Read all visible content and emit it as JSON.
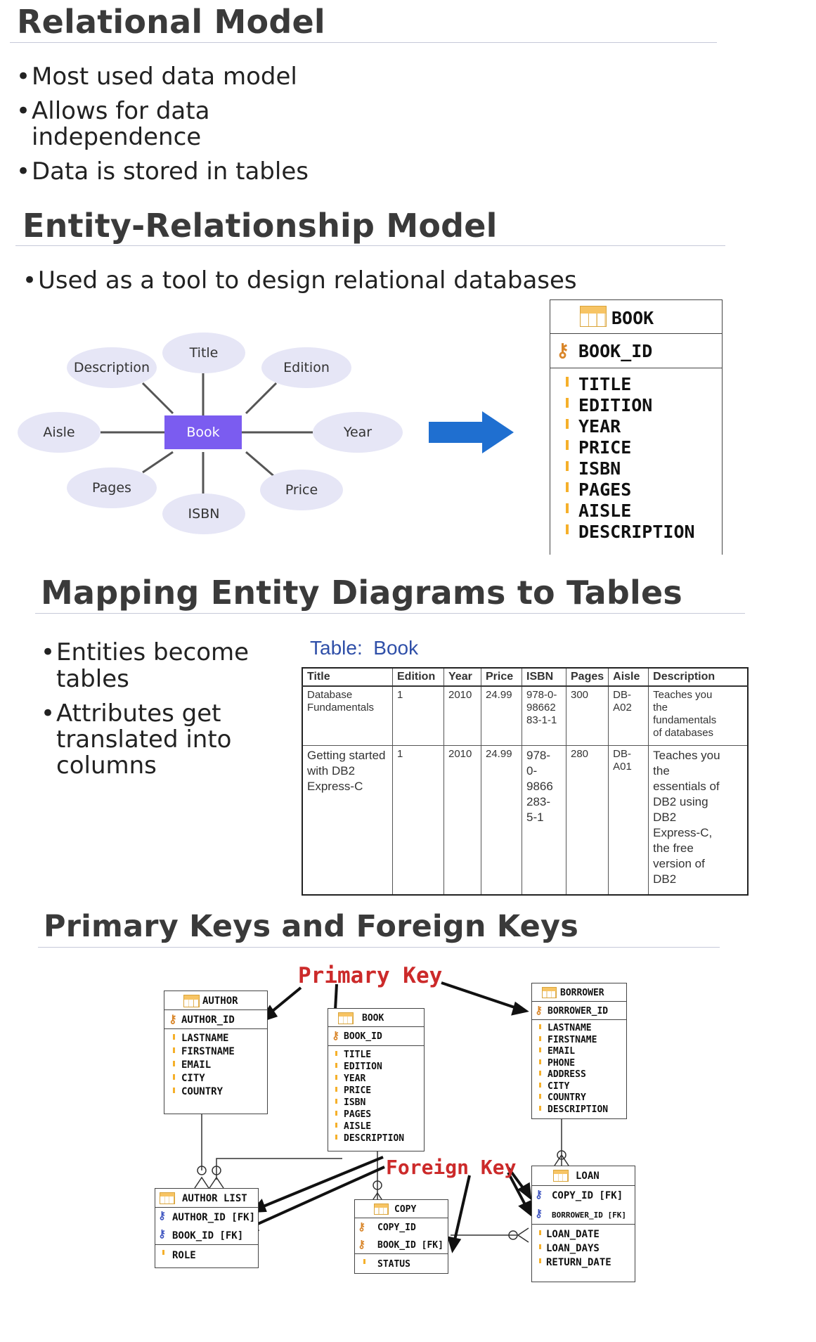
{
  "section1": {
    "title": "Relational Model",
    "bullets": [
      "Most used data model",
      "Allows for data",
      "independence",
      "Data is stored in tables"
    ]
  },
  "section2": {
    "title": "Entity-Relationship Model",
    "bullet": "Used as a tool to design relational databases",
    "diagram": {
      "center": "Book",
      "attributes": [
        "Title",
        "Description",
        "Edition",
        "Aisle",
        "Year",
        "Pages",
        "Price",
        "ISBN"
      ]
    },
    "entity": {
      "name": "BOOK",
      "pk": "BOOK_ID",
      "attrs": [
        "TITLE",
        "EDITION",
        "YEAR",
        "PRICE",
        "ISBN",
        "PAGES",
        "AISLE",
        "DESCRIPTION"
      ]
    },
    "colors": {
      "center_box": "#7b5cf0",
      "ellipse": "#e6e6f6",
      "arrow": "#1f6fd0"
    }
  },
  "section3": {
    "title": "Mapping Entity Diagrams to Tables",
    "bullets": [
      "Entities become",
      "tables",
      "Attributes get",
      "translated into",
      "columns"
    ],
    "table_caption": "Table:  Book",
    "headers": [
      "Title",
      "Edition",
      "Year",
      "Price",
      "ISBN",
      "Pages",
      "Aisle",
      "Description"
    ],
    "rows": [
      [
        "Database\nFundamentals",
        "1",
        "2010",
        "24.99",
        "978-0-\n98662\n83-1-1",
        "300",
        "DB-\nA02",
        "Teaches you\nthe\nfundamentals\nof databases"
      ],
      [
        "Getting started\nwith DB2\nExpress-C",
        "1",
        "2010",
        "24.99",
        "978-\n0-\n9866\n283-\n5-1",
        "280",
        "DB-\nA01",
        "Teaches you\nthe\nessentials of\nDB2 using\nDB2\nExpress-C,\nthe free\nversion of\nDB2"
      ]
    ]
  },
  "section4": {
    "title": "Primary Keys and Foreign Keys",
    "primary_key_label": "Primary Key",
    "foreign_key_label": "Foreign Key",
    "author": {
      "name": "AUTHOR",
      "pk": "AUTHOR_ID",
      "attrs": [
        "LASTNAME",
        "FIRSTNAME",
        "EMAIL",
        "CITY",
        "COUNTRY"
      ]
    },
    "book": {
      "name": "BOOK",
      "pk": "BOOK_ID",
      "attrs": [
        "TITLE",
        "EDITION",
        "YEAR",
        "PRICE",
        "ISBN",
        "PAGES",
        "AISLE",
        "DESCRIPTION"
      ]
    },
    "borrower": {
      "name": "BORROWER",
      "pk": "BORROWER_ID",
      "attrs": [
        "LASTNAME",
        "FIRSTNAME",
        "EMAIL",
        "PHONE",
        "ADDRESS",
        "CITY",
        "COUNTRY",
        "DESCRIPTION"
      ]
    },
    "author_list": {
      "name": "AUTHOR LIST",
      "keys": [
        "AUTHOR_ID [FK]",
        "BOOK_ID [FK]"
      ],
      "attrs": [
        "ROLE"
      ]
    },
    "copy": {
      "name": "COPY",
      "keys": [
        "COPY_ID",
        "BOOK_ID [FK]"
      ],
      "attrs": [
        "STATUS"
      ]
    },
    "loan": {
      "name": "LOAN",
      "keys": [
        "COPY_ID [FK]",
        "BORROWER_ID [FK]"
      ],
      "attrs": [
        "LOAN_DATE",
        "LOAN_DAYS",
        "RETURN_DATE"
      ]
    }
  }
}
